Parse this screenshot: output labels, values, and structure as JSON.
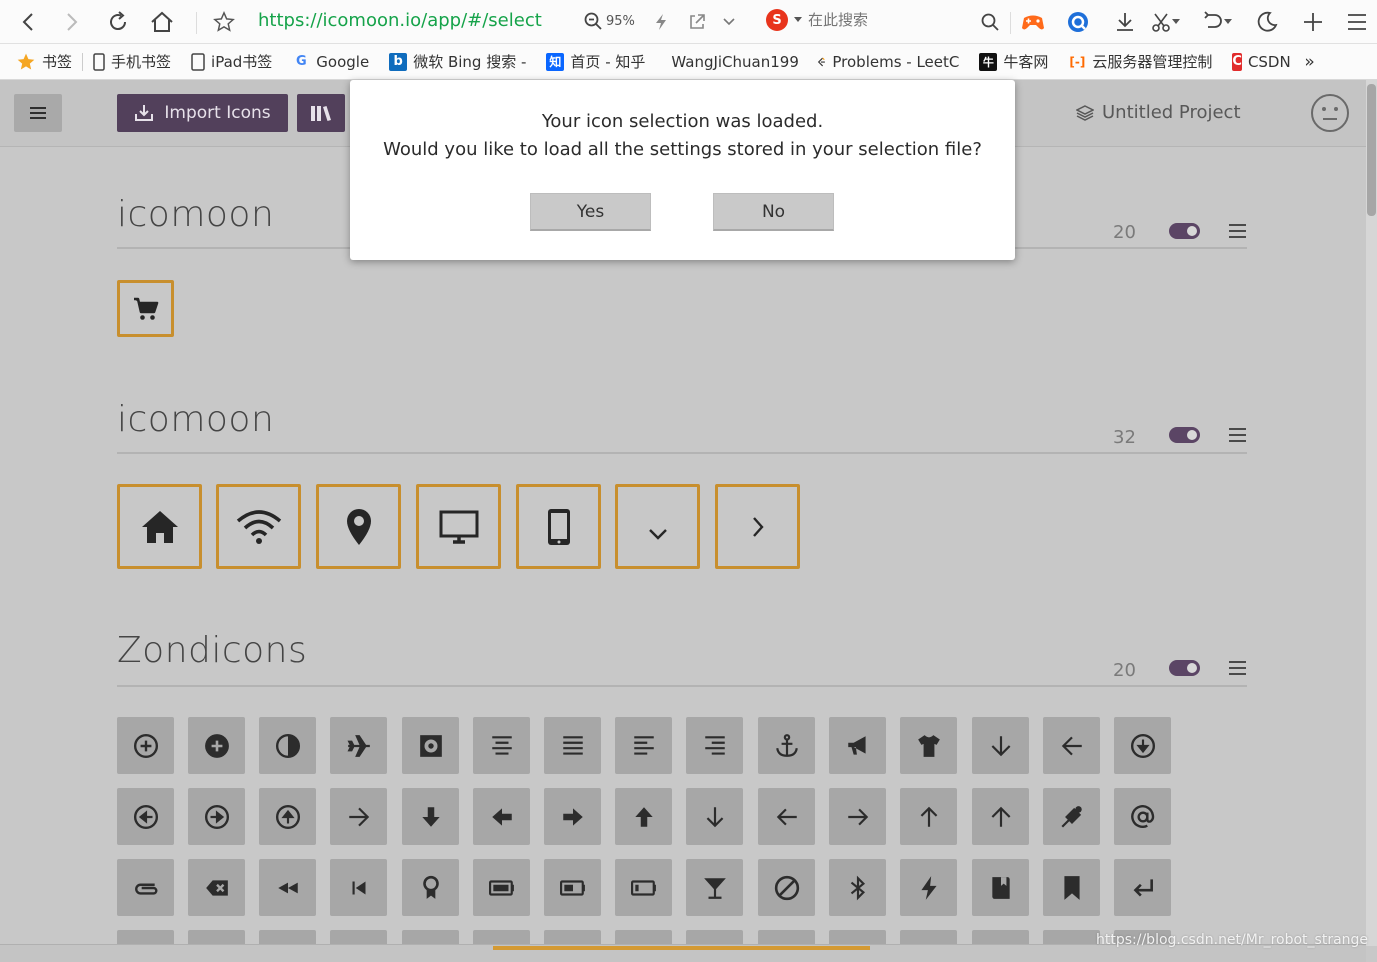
{
  "browser": {
    "url": "https://icomoon.io/app/#/select",
    "zoom": "95%",
    "search_placeholder": "在此搜索",
    "search_engine_letter": "S",
    "bookmarks": [
      {
        "label": "书签",
        "icon": "star-icon",
        "color": "#f5a623"
      },
      {
        "label": "手机书签",
        "icon": "phone-icon",
        "color": "#444444"
      },
      {
        "label": "iPad书签",
        "icon": "tablet-icon",
        "color": "#444444"
      },
      {
        "label": "Google",
        "icon": "google-icon",
        "color": "#4285f4",
        "glyph": "G"
      },
      {
        "label": "微软 Bing 搜索 -",
        "icon": "bing-icon",
        "color": "#0f6cbd",
        "glyph": "b"
      },
      {
        "label": "首页 - 知乎",
        "icon": "zhihu-icon",
        "color": "#0a66ff",
        "glyph": "知"
      },
      {
        "label": "WangJiChuan199",
        "icon": "github-icon",
        "color": "#222222",
        "glyph": "●"
      },
      {
        "label": "Problems - LeetC",
        "icon": "leetcode-icon",
        "color": "#333333",
        "glyph": "‹"
      },
      {
        "label": "牛客网",
        "icon": "nowcoder-icon",
        "color": "#111111",
        "glyph": "牛"
      },
      {
        "label": "云服务器管理控制",
        "icon": "aliyun-icon",
        "color": "#ff6a00",
        "glyph": "[-]"
      },
      {
        "label": "CSDN",
        "icon": "csdn-icon",
        "color": "#e12b2b",
        "glyph": "C"
      }
    ],
    "more": "»"
  },
  "header": {
    "import_label": "Import Icons",
    "project_label": "Untitled Project"
  },
  "dialog": {
    "line1": "Your icon selection was loaded.",
    "line2": "Would you like to load all the settings stored in your selection file?",
    "yes_label": "Yes",
    "no_label": "No"
  },
  "sets": [
    {
      "title": "icomoon",
      "count": "20"
    },
    {
      "title": "icomoon",
      "count": "32"
    },
    {
      "title": "Zondicons",
      "count": "20"
    }
  ],
  "set1_icons": [
    "cart-icon"
  ],
  "set2_icons": [
    "home-icon",
    "wifi-icon",
    "location-icon",
    "display-icon",
    "mobile-icon",
    "chevron-down-icon",
    "chevron-right-icon"
  ],
  "zondicons_rows": [
    [
      "add-outline-icon",
      "add-solid-icon",
      "adjust-icon",
      "airplane-icon",
      "album-icon",
      "align-center-icon",
      "align-justified-icon",
      "align-left-icon",
      "align-right-icon",
      "anchor-icon",
      "announcement-icon",
      "apparel-icon",
      "arrow-down-icon",
      "arrow-left-icon",
      "arrow-outline-down-icon"
    ],
    [
      "arrow-outline-left-icon",
      "arrow-outline-right-icon",
      "arrow-outline-up-icon",
      "arrow-right-icon",
      "arrow-thick-down-icon",
      "arrow-thick-left-icon",
      "arrow-thick-right-icon",
      "arrow-thick-up-icon",
      "arrow-thin-down-icon",
      "arrow-thin-left-icon",
      "arrow-thin-right-icon",
      "arrow-thin-up-icon",
      "arrow-up-icon",
      "artist-icon",
      "at-symbol-icon"
    ],
    [
      "attachment-icon",
      "backspace-icon",
      "backward-icon",
      "backward-step-icon",
      "badge-icon",
      "battery-full-icon",
      "battery-half-icon",
      "battery-low-icon",
      "beverage-icon",
      "block-icon",
      "bluetooth-icon",
      "bolt-icon",
      "book-reference-icon",
      "bookmark-icon",
      "enter-icon"
    ]
  ],
  "watermark": "https://blog.csdn.net/Mr_robot_strange"
}
